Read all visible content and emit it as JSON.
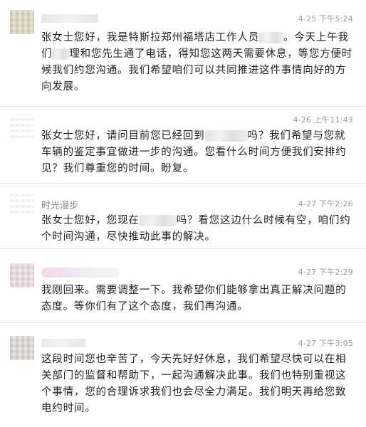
{
  "messages": [
    {
      "name": "",
      "time": "4-25 下午5:24",
      "avatar_color": "#d9d2c0",
      "text_a": "张女士您好，我是特斯拉郑州福塔店工作人员",
      "text_b": "。今天上午我们",
      "text_c": "理和您先生通了电话，得知您这两天需要休息，等您方便时候我们约您沟通。我们希望咱们可以共同推进这件事情向好的方向发展。"
    },
    {
      "name": "",
      "time": "4-26 上午11:43",
      "avatar_color": "#ffffff",
      "text_a": "张女士您好，请问目前您已经回到",
      "text_b": "吗？我们希望与您就车辆的鉴定事宜做进一步的沟通。您看什么时间方便我们安排约见？我们尊重您的时间。盼复。"
    },
    {
      "name": "时光漫步",
      "time": "4-27 下午2:26",
      "avatar_color": "#ffffff",
      "text_a": "张女士您好，您现在",
      "text_b": "吗？看您这边什么时候有空，咱们约个时间沟通，尽快推动此事的解决。"
    },
    {
      "name": "",
      "time": "4-27 下午2:29",
      "avatar_color": "#e9d9dd",
      "text": "我刚回来。需要调整一下。我希望你们能够拿出真正解决问题的态度。等你们有了这个态度，我们再沟通。"
    },
    {
      "name": "",
      "time": "4-27 下午3:05",
      "avatar_color": "#d8d4cf",
      "text": "这段时间您也辛苦了，今天先好好休息，我们希望尽快可以在相关部门的监督和帮助下，一起沟通解决此事。我们也特别重视这个事情，您的合理诉求我们也会尽全力满足。我们明天再给您致电约时间。"
    }
  ]
}
